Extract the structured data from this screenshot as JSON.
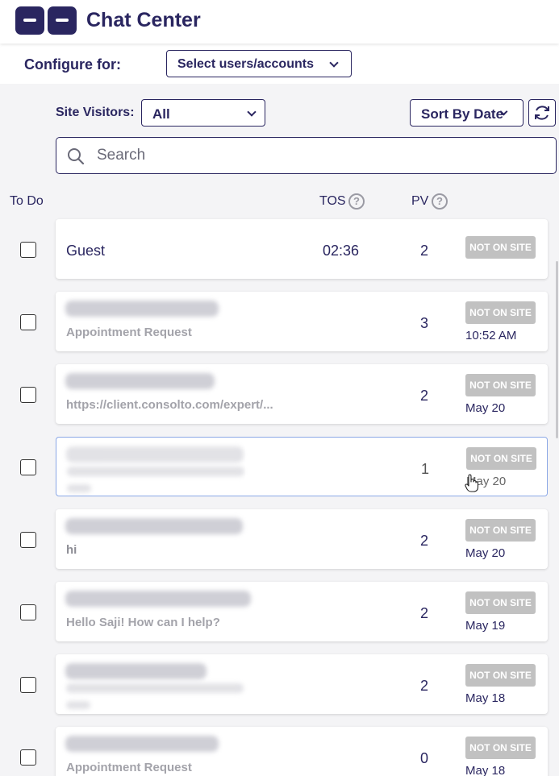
{
  "header": {
    "title": "Chat Center",
    "logo_icon": "chat-logo-icon"
  },
  "configure": {
    "label": "Configure for:",
    "select_value": "Select users/accounts"
  },
  "filters": {
    "site_visitors_label": "Site Visitors:",
    "site_visitors_value": "All",
    "sort_label": "Sort By Date",
    "refresh_icon": "refresh-icon"
  },
  "search": {
    "placeholder": "Search"
  },
  "columns": {
    "todo": "To Do",
    "tos": "TOS",
    "pv": "PV",
    "help_mark": "?"
  },
  "colors": {
    "primary": "#2a2660",
    "badge": "#c1c1c1",
    "background": "#f4f4f6"
  },
  "rows": [
    {
      "name": "Guest",
      "preview": "",
      "tos": "02:36",
      "pv": "2",
      "badge": "NOT ON SITE",
      "date": ""
    },
    {
      "name": "",
      "preview": "Appointment Request",
      "tos": "",
      "pv": "3",
      "badge": "NOT ON SITE",
      "date": "10:52 AM"
    },
    {
      "name": "",
      "preview": "https://client.consolto.com/expert/...",
      "tos": "",
      "pv": "2",
      "badge": "NOT ON SITE",
      "date": "May 20"
    },
    {
      "name": "",
      "preview": "",
      "tos": "",
      "pv": "1",
      "badge": "NOT ON SITE",
      "date": "May 20"
    },
    {
      "name": "",
      "preview": "hi",
      "tos": "",
      "pv": "2",
      "badge": "NOT ON SITE",
      "date": "May 20"
    },
    {
      "name": "",
      "preview": "Hello Saji! How can I help?",
      "tos": "",
      "pv": "2",
      "badge": "NOT ON SITE",
      "date": "May 19"
    },
    {
      "name": "",
      "preview": "",
      "tos": "",
      "pv": "2",
      "badge": "NOT ON SITE",
      "date": "May 18"
    },
    {
      "name": "",
      "preview": "Appointment Request",
      "tos": "",
      "pv": "0",
      "badge": "NOT ON SITE",
      "date": "May 18"
    }
  ]
}
